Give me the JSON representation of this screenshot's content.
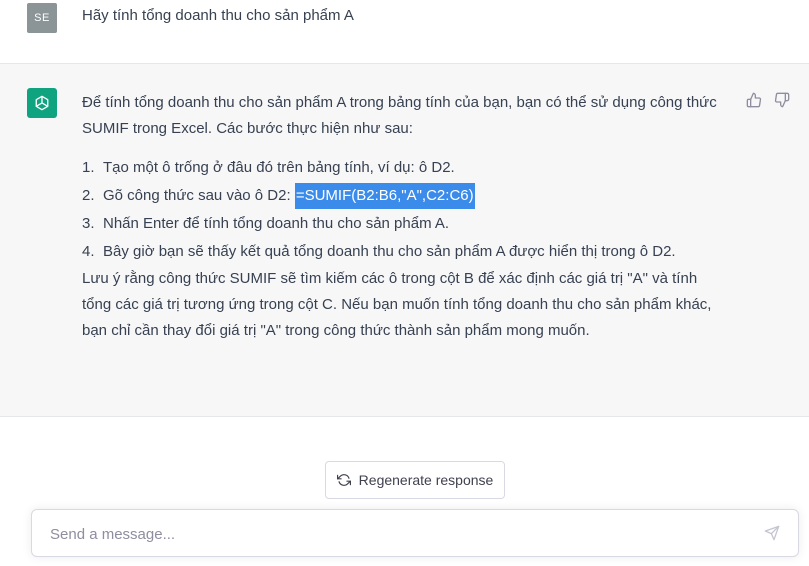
{
  "user": {
    "avatar_initials": "SE",
    "message": "Hãy tính tổng doanh thu cho sản phẩm A"
  },
  "assistant": {
    "avatar_icon": "openai-logo-icon",
    "intro": "Để tính tổng doanh thu cho sản phẩm A trong bảng tính của bạn, bạn có thể sử dụng công thức SUMIF trong Excel. Các bước thực hiện như sau:",
    "steps": [
      {
        "num": "1.",
        "text": "Tạo một ô trống ở đâu đó trên bảng tính, ví dụ: ô D2."
      },
      {
        "num": "2.",
        "text": "Gõ công thức sau vào ô D2: ",
        "highlight": "=SUMIF(B2:B6,\"A\",C2:C6)"
      },
      {
        "num": "3.",
        "text": "Nhấn Enter để tính tổng doanh thu cho sản phẩm A."
      },
      {
        "num": "4.",
        "text": "Bây giờ bạn sẽ thấy kết quả tổng doanh thu cho sản phẩm A được hiển thị trong ô D2."
      }
    ],
    "note": "Lưu ý rằng công thức SUMIF sẽ tìm kiếm các ô trong cột B để xác định các giá trị \"A\" và tính tổng các giá trị tương ứng trong cột C. Nếu bạn muốn tính tổng doanh thu cho sản phẩm khác, bạn chỉ cần thay đổi giá trị \"A\" trong công thức thành sản phẩm mong muốn.",
    "feedback_icons": [
      "thumbs-up-icon",
      "thumbs-down-icon"
    ]
  },
  "regenerate": {
    "label": "Regenerate response",
    "icon": "refresh-icon"
  },
  "composer": {
    "placeholder": "Send a message...",
    "value": "",
    "send_icon": "send-icon"
  },
  "colors": {
    "assistant_bg": "#f7f7f8",
    "bot_avatar": "#10a37f",
    "user_avatar": "#8b9496",
    "highlight": "#3b8beb"
  }
}
